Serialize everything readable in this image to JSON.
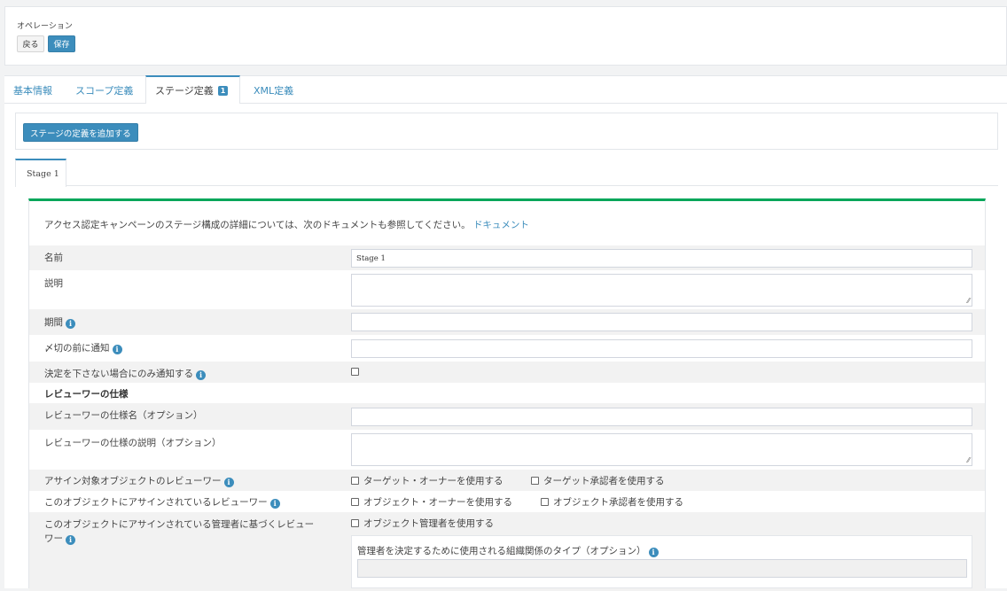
{
  "operations": {
    "label": "オペレーション",
    "back_label": "戻る",
    "save_label": "保存"
  },
  "tabs": {
    "basic": "基本情報",
    "scope": "スコープ定義",
    "stage": "ステージ定義",
    "stage_badge": "1",
    "xml": "XML定義"
  },
  "add_stage_label": "ステージの定義を追加する",
  "stage_tab_label": "Stage 1",
  "doc_note": {
    "text": "アクセス認定キャンペーンのステージ構成の詳細については、次のドキュメントも参照してください。",
    "link": "ドキュメント"
  },
  "form": {
    "name_label": "名前",
    "name_value": "Stage 1",
    "description_label": "説明",
    "duration_label": "期間",
    "notify_before_label": "〆切の前に通知",
    "notify_only_label": "決定を下さない場合にのみ通知する",
    "notify_only_checked": false,
    "reviewer_spec_heading": "レビューワーの仕様",
    "spec_name_label": "レビューワーの仕様名（オプション）",
    "spec_desc_label": "レビューワーの仕様の説明（オプション）",
    "assigned_target_label": "アサイン対象オブジェクトのレビューワー",
    "opt_target_owner": "ターゲット・オーナーを使用する",
    "opt_target_approver": "ターゲット承認者を使用する",
    "assigned_object_label": "このオブジェクトにアサインされているレビューワー",
    "opt_object_owner": "オブジェクト・オーナーを使用する",
    "opt_object_approver": "オブジェクト承認者を使用する",
    "manager_based_label_line1": "このオブジェクトにアサインされている管理者に基づくレビュー",
    "manager_based_label_line2": "ワー",
    "opt_object_manager": "オブジェクト管理者を使用する",
    "org_relation_label": "管理者を決定するために使用される組織関係のタイプ（オプション）"
  },
  "colors": {
    "primary": "#3c8dbc",
    "success_border": "#00a65a",
    "row_alt": "#f2f2f2"
  }
}
